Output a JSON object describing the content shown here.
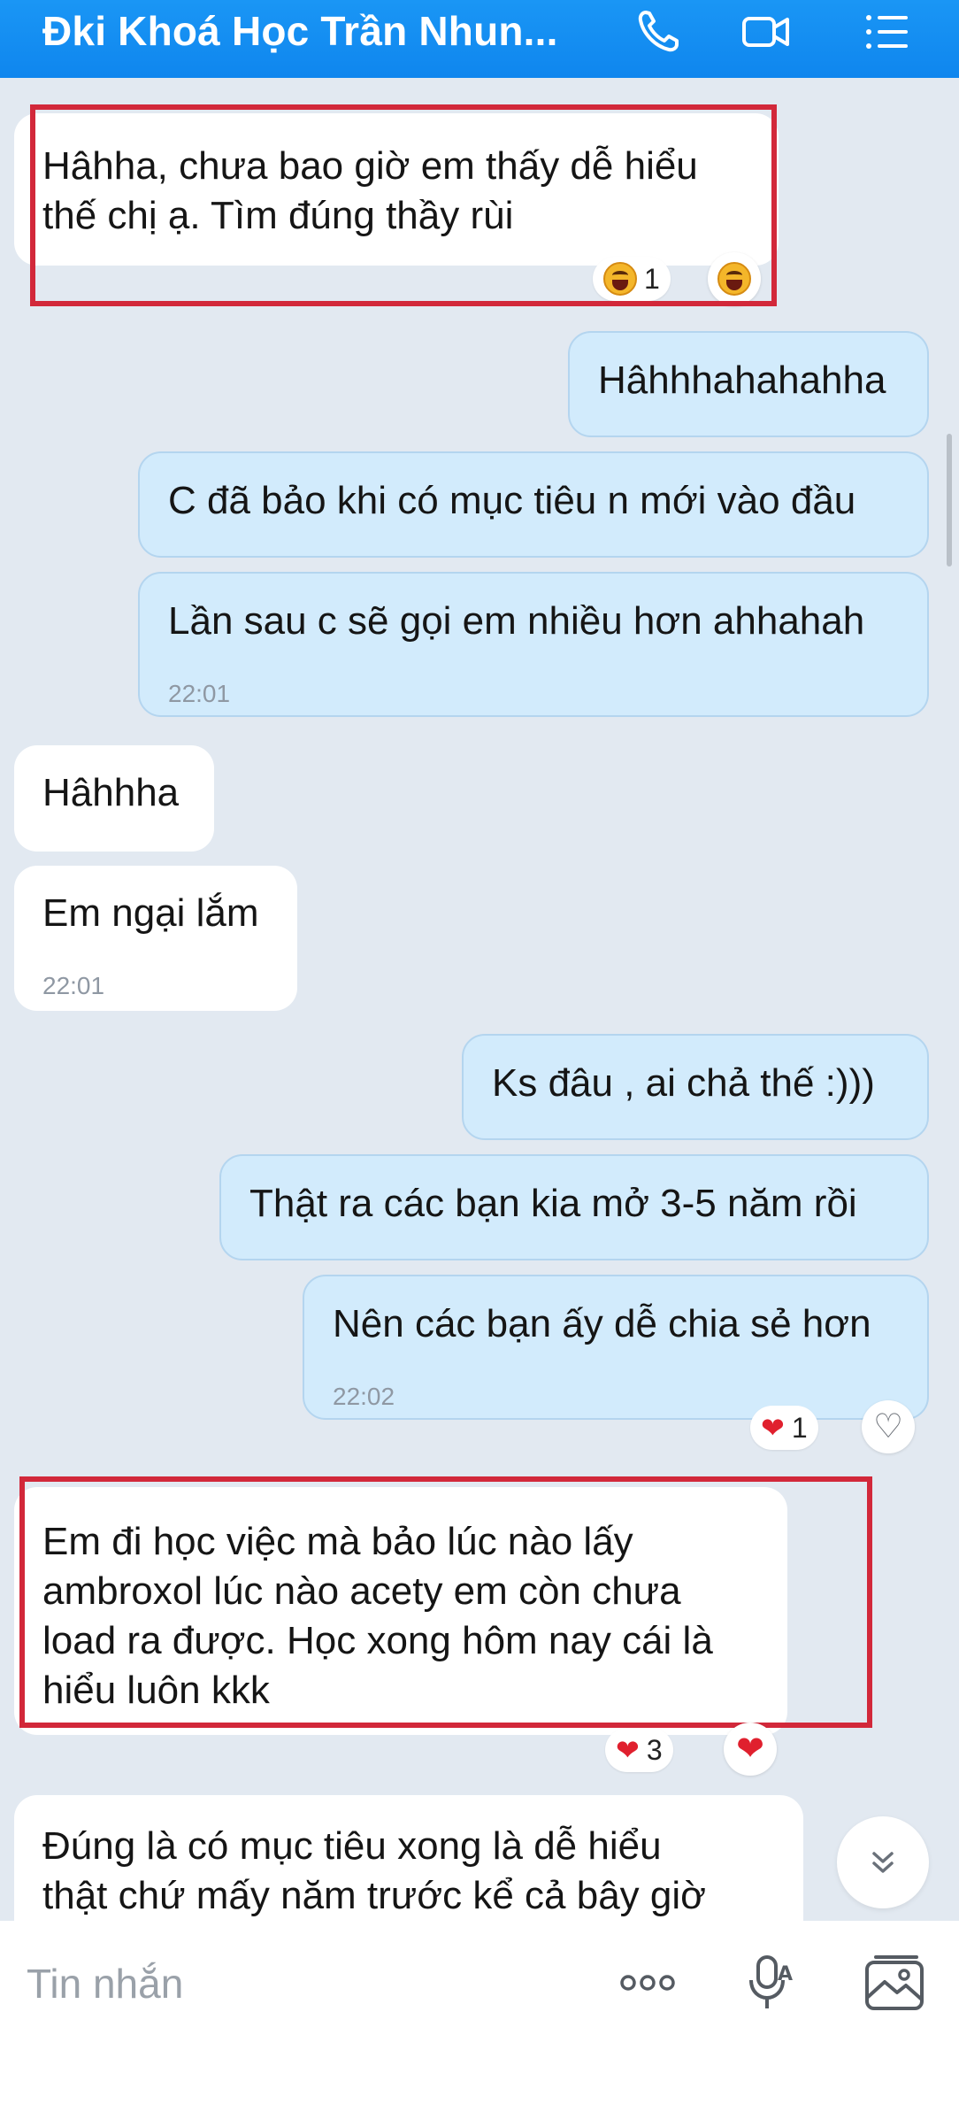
{
  "header": {
    "title": "Đki Khoá Học Trần Nhun...",
    "icons": [
      "phone-icon",
      "video-call-icon",
      "menu-list-icon"
    ]
  },
  "messages": [
    {
      "id": "m1",
      "side": "in",
      "lines": [
        "Hâhha, chưa bao giờ em thấy dễ hiểu",
        "thế chị ạ. Tìm đúng thầy rùi"
      ],
      "reaction": {
        "icon": "laugh-emoji-icon",
        "count": "1"
      }
    },
    {
      "id": "m2",
      "side": "out",
      "lines": [
        "Hâhhhahahahha"
      ]
    },
    {
      "id": "m3",
      "side": "out",
      "lines": [
        "C đã bảo khi có mục tiêu n mới vào đầu"
      ]
    },
    {
      "id": "m4",
      "side": "out",
      "lines": [
        "Lần sau c sẽ gọi em nhiều hơn ahhahah"
      ],
      "time": "22:01"
    },
    {
      "id": "m5",
      "side": "in",
      "lines": [
        "Hâhhha"
      ]
    },
    {
      "id": "m6",
      "side": "in",
      "lines": [
        "Em ngại lắm"
      ],
      "time": "22:01"
    },
    {
      "id": "m7",
      "side": "out",
      "lines": [
        "Ks đâu , ai chả thế :)))"
      ]
    },
    {
      "id": "m8",
      "side": "out",
      "lines": [
        "Thật ra các bạn kia mở 3-5 năm rồi"
      ]
    },
    {
      "id": "m9",
      "side": "out",
      "lines": [
        "Nên các bạn ấy dễ chia sẻ hơn"
      ],
      "time": "22:02",
      "reaction": {
        "icon": "heart-icon",
        "count": "1"
      }
    },
    {
      "id": "m10",
      "side": "in",
      "lines": [
        "Em đi học việc mà bảo lúc nào lấy",
        "ambroxol lúc nào acety em còn chưa",
        "load ra được. Học xong hôm nay cái là",
        "hiểu luôn kkk"
      ],
      "reaction": {
        "icon": "heart-icon",
        "count": "3"
      }
    },
    {
      "id": "m11",
      "side": "in",
      "lines": [
        "Đúng là có mục tiêu xong là dễ hiểu",
        "thật chứ mấy năm trước kể cả bây giờ"
      ]
    }
  ],
  "composer": {
    "placeholder": "Tin nhắn",
    "icons": [
      "more-options-icon",
      "voice-to-text-icon",
      "image-gallery-icon"
    ]
  },
  "colors": {
    "header": "#1a96f5",
    "background": "#e2e9f1",
    "outgoing_bubble": "#d2ebfc",
    "incoming_bubble": "#ffffff",
    "highlight_box": "#d2283a",
    "heart": "#e0202e"
  }
}
